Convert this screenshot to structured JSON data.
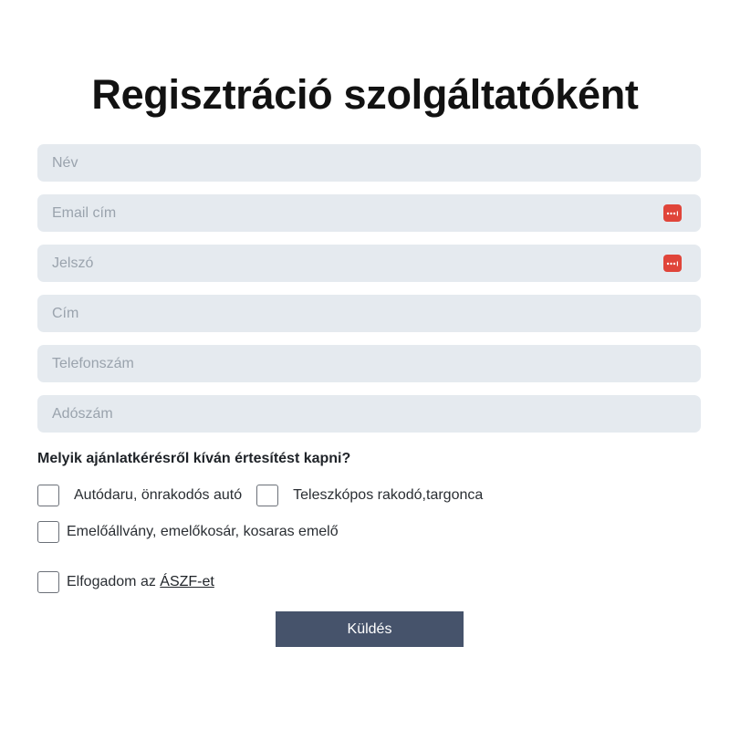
{
  "page": {
    "title": "Regisztráció szolgáltatóként"
  },
  "form": {
    "fields": [
      {
        "placeholder": "Név",
        "value": "",
        "icon": null
      },
      {
        "placeholder": "Email cím",
        "value": "",
        "icon": "password-manager-icon"
      },
      {
        "placeholder": "Jelszó",
        "value": "",
        "icon": "password-manager-icon"
      },
      {
        "placeholder": "Cím",
        "value": "",
        "icon": null
      },
      {
        "placeholder": "Telefonszám",
        "value": "",
        "icon": null
      },
      {
        "placeholder": "Adószám",
        "value": "",
        "icon": null
      }
    ],
    "question": "Melyik ajánlatkérésről kíván értesítést kapni?",
    "options": [
      {
        "label": "Autódaru, önrakodós autó",
        "checked": false
      },
      {
        "label": "Teleszkópos rakodó,targonca",
        "checked": false
      },
      {
        "label": "Emelőállvány, emelőkosár, kosaras emelő",
        "checked": false
      }
    ],
    "terms": {
      "prefix": "Elfogadom az ",
      "link": "ÁSZF-et",
      "checked": false
    },
    "submit_label": "Küldés"
  },
  "colors": {
    "field_bg": "#e5eaef",
    "icon_red": "#e0453a",
    "button_bg": "#46536b"
  }
}
